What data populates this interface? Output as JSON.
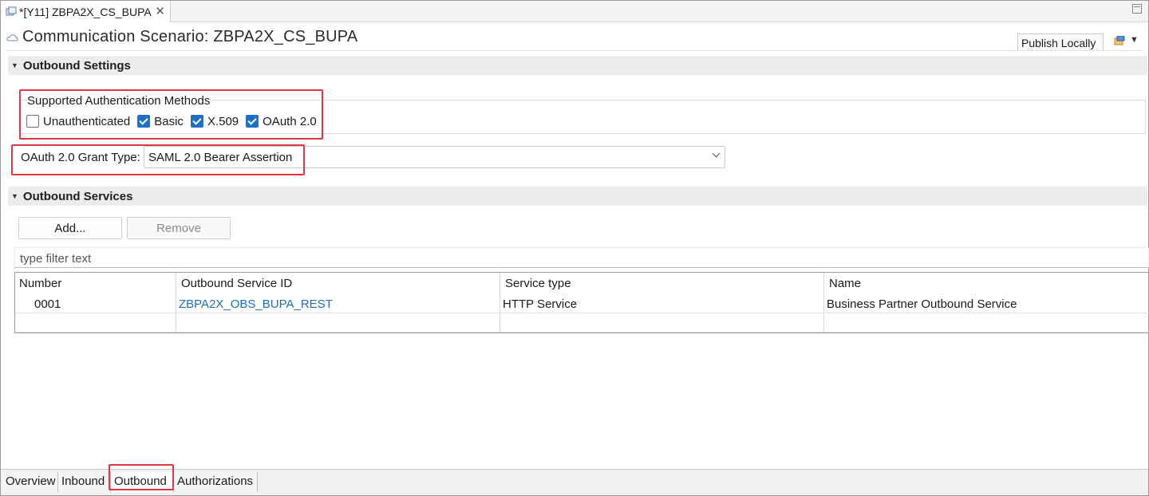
{
  "editor_tab": {
    "label": "*[Y11] ZBPA2X_CS_BUPA",
    "close": "✕"
  },
  "header": {
    "title": "Communication Scenario: ZBPA2X_CS_BUPA",
    "publish_label": "Publish Locally"
  },
  "outbound_settings": {
    "section_title": "Outbound Settings",
    "auth_group_label": "Supported Authentication Methods",
    "methods": [
      {
        "label": "Unauthenticated",
        "checked": false
      },
      {
        "label": "Basic",
        "checked": true
      },
      {
        "label": "X.509",
        "checked": true
      },
      {
        "label": "OAuth 2.0",
        "checked": true
      }
    ],
    "grant_type_label": "OAuth 2.0 Grant Type:",
    "grant_type_value": "SAML 2.0 Bearer Assertion"
  },
  "outbound_services": {
    "section_title": "Outbound Services",
    "add_label": "Add...",
    "remove_label": "Remove",
    "filter_placeholder": "type filter text",
    "columns": [
      "Number",
      "Outbound Service ID",
      "Service type",
      "Name"
    ],
    "rows": [
      {
        "number": "0001",
        "service_id": "ZBPA2X_OBS_BUPA_REST",
        "service_type": "HTTP Service",
        "name": "Business Partner Outbound Service"
      }
    ]
  },
  "bottom_tabs": [
    "Overview",
    "Inbound",
    "Outbound",
    "Authorizations"
  ],
  "colors": {
    "highlight": "#e0383e",
    "checkbox": "#1f6fc4",
    "link": "#1a6fc2",
    "section_bg": "#ececec"
  }
}
